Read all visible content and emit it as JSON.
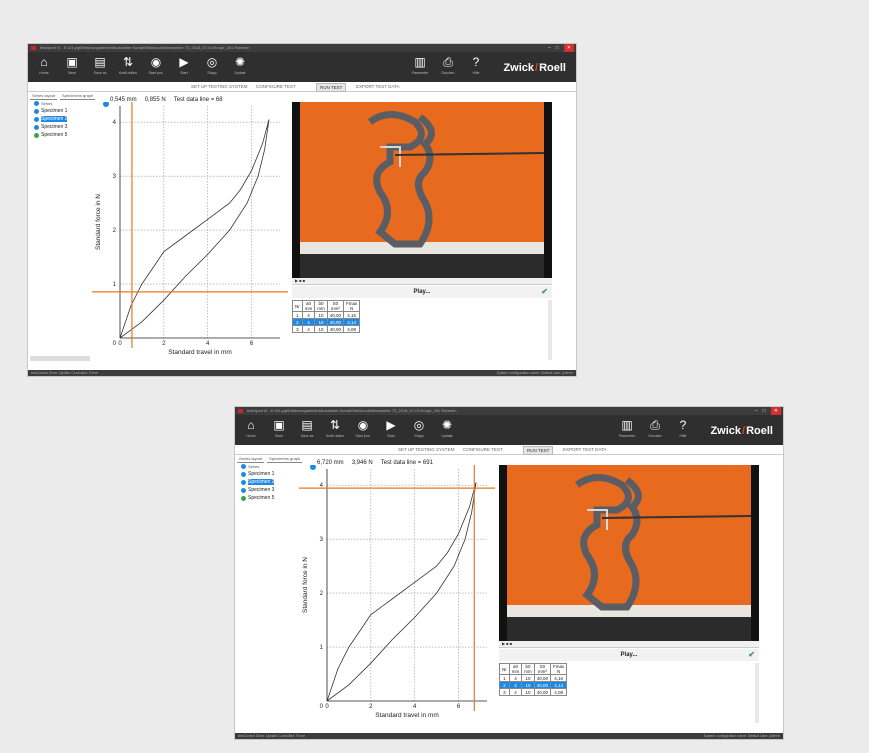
{
  "window": {
    "title": "testXpert III - E:\\Z4.yqt\\Erfahrungsbericht\\Aussteller Kunde\\Strichcode\\Messreihe 73_2018_07-01\\Knopf_281 Rahmen",
    "controls": {
      "minimize": "–",
      "maximize": "□",
      "close": "✕"
    }
  },
  "toolbar": {
    "buttons": [
      {
        "label": "Home",
        "icon": "home-icon"
      },
      {
        "label": "Save",
        "icon": "save-icon"
      },
      {
        "label": "Save as",
        "icon": "save-as-icon"
      },
      {
        "label": "Kraft-nullen",
        "icon": "force-zero-icon"
      },
      {
        "label": "Start pos.",
        "icon": "start-position-icon"
      },
      {
        "label": "Start",
        "icon": "start-icon"
      },
      {
        "label": "Stopp",
        "icon": "stop-icon"
      },
      {
        "label": "Update",
        "icon": "update-icon"
      }
    ],
    "right_buttons": [
      {
        "label": "Parameter",
        "icon": "parameter-icon"
      },
      {
        "label": "Drucken",
        "icon": "print-icon"
      },
      {
        "label": "Hilfe",
        "icon": "help-icon"
      }
    ],
    "brand_left": "Zwick",
    "brand_right": "Roell"
  },
  "tabs": [
    "SET UP TESTING SYSTEM",
    "CONFIGURE TEST",
    "RUN TEST",
    "EXPORT TEST DATA"
  ],
  "active_tab": "RUN TEST",
  "subtabs": [
    "Series layout",
    "Specimens graph"
  ],
  "tree": {
    "root": "Series",
    "items": [
      "Specimen 1",
      "Specimen 2",
      "Specimen 3",
      "Specimen 5"
    ]
  },
  "video": {
    "play_label": "Play...",
    "controls": "▶  ■  ■"
  },
  "results": {
    "headers": [
      [
        "Nr",
        ""
      ],
      [
        "a0",
        "mm"
      ],
      [
        "b0",
        "mm"
      ],
      [
        "S0",
        "mm²"
      ],
      [
        "Fmax",
        "N"
      ]
    ],
    "rows": [
      [
        "1",
        "4",
        "10",
        "40,00",
        "4,16"
      ],
      [
        "2",
        "4",
        "10",
        "40,00",
        "4,14"
      ],
      [
        "3",
        "4",
        "10",
        "40,00",
        "4,08"
      ]
    ]
  },
  "status": {
    "left": "testControl   Drive: Update   Controlled: Force",
    "right": "System configuration name: Default   User: jufferm"
  },
  "screens": [
    {
      "readout_travel": "0,545 mm",
      "readout_force": "0,855 N",
      "readout_line": "Test data line = 68",
      "cursor_x": 0.545,
      "cursor_y": 0.855
    },
    {
      "readout_travel": "6,720 mm",
      "readout_force": "3,946 N",
      "readout_line": "Test data line = 691",
      "cursor_x": 6.72,
      "cursor_y": 3.946
    }
  ],
  "chart_data": {
    "type": "line",
    "xlabel": "Standard travel in mm",
    "ylabel": "Standard force in N",
    "xlim": [
      0,
      7.3
    ],
    "ylim": [
      0,
      4.3
    ],
    "xticks": [
      0,
      2,
      4,
      6
    ],
    "yticks": [
      1,
      2,
      3,
      4
    ],
    "series": [
      {
        "x": [
          0,
          0.5,
          1,
          1.5,
          2,
          3,
          4,
          5,
          5.5,
          6,
          6.5,
          6.8
        ],
        "y": [
          0,
          0.6,
          1.0,
          1.3,
          1.6,
          1.9,
          2.2,
          2.5,
          2.75,
          3.1,
          3.6,
          4.05
        ]
      },
      {
        "x": [
          0,
          1,
          2,
          3,
          4,
          5,
          5.8,
          6.3,
          6.6,
          6.8
        ],
        "y": [
          0,
          0.3,
          0.7,
          1.15,
          1.55,
          2.0,
          2.5,
          3.0,
          3.5,
          4.05
        ]
      }
    ]
  },
  "colors": {
    "accent": "#e07b22",
    "selection": "#1e88e5",
    "toolbar": "#2f2f2f",
    "video_bg": "#e86a1e"
  }
}
